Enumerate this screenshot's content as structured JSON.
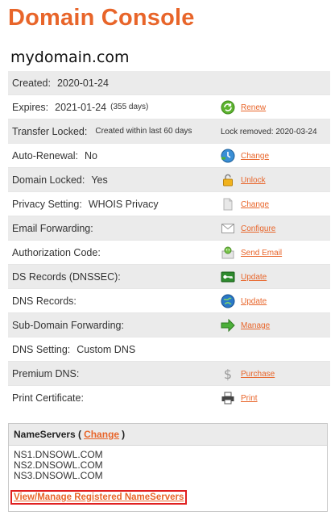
{
  "page": {
    "title": "Domain Console",
    "domain_name": "mydomain.com"
  },
  "rows": [
    {
      "label": "Created:",
      "value": "2020-01-24"
    },
    {
      "label": "Expires:",
      "value": "2021-01-24",
      "sub": "(355 days)",
      "action": "Renew",
      "icon": "renew-icon"
    },
    {
      "label": "Transfer Locked:",
      "value": "Created within last 60 days",
      "note": "Lock removed: 2020-03-24"
    },
    {
      "label": "Auto-Renewal:",
      "value": "No",
      "action": "Change",
      "icon": "clock-icon"
    },
    {
      "label": "Domain Locked:",
      "value": "Yes",
      "action": "Unlock",
      "icon": "lock-icon"
    },
    {
      "label": "Privacy Setting:",
      "value": "WHOIS Privacy",
      "action": "Change",
      "icon": "document-icon"
    },
    {
      "label": "Email Forwarding:",
      "value": "",
      "action": "Configure",
      "icon": "envelope-icon"
    },
    {
      "label": "Authorization Code:",
      "value": "",
      "action": "Send Email",
      "icon": "mail-robot-icon"
    },
    {
      "label": "DS Records (DNSSEC):",
      "value": "",
      "action": "Update",
      "icon": "key-icon"
    },
    {
      "label": "DNS Records:",
      "value": "",
      "action": "Update",
      "icon": "globe-icon"
    },
    {
      "label": "Sub-Domain Forwarding:",
      "value": "",
      "action": "Manage",
      "icon": "arrow-right-icon"
    },
    {
      "label": "DNS Setting:",
      "value": "Custom DNS"
    },
    {
      "label": "Premium DNS:",
      "value": "",
      "action": "Purchase",
      "icon": "dollar-icon"
    },
    {
      "label": "Print Certificate:",
      "value": "",
      "action": "Print",
      "icon": "printer-icon"
    }
  ],
  "nameservers": {
    "header_label": "NameServers (",
    "change_label": "Change",
    "header_close": ")",
    "servers": [
      "NS1.DNSOWL.COM",
      "NS2.DNSOWL.COM",
      "NS3.DNSOWL.COM"
    ],
    "manage_link": "View/Manage Registered NameServers"
  },
  "colors": {
    "accent": "#e8652a",
    "row_alt": "#ebebeb",
    "highlight_border": "#e02020"
  }
}
